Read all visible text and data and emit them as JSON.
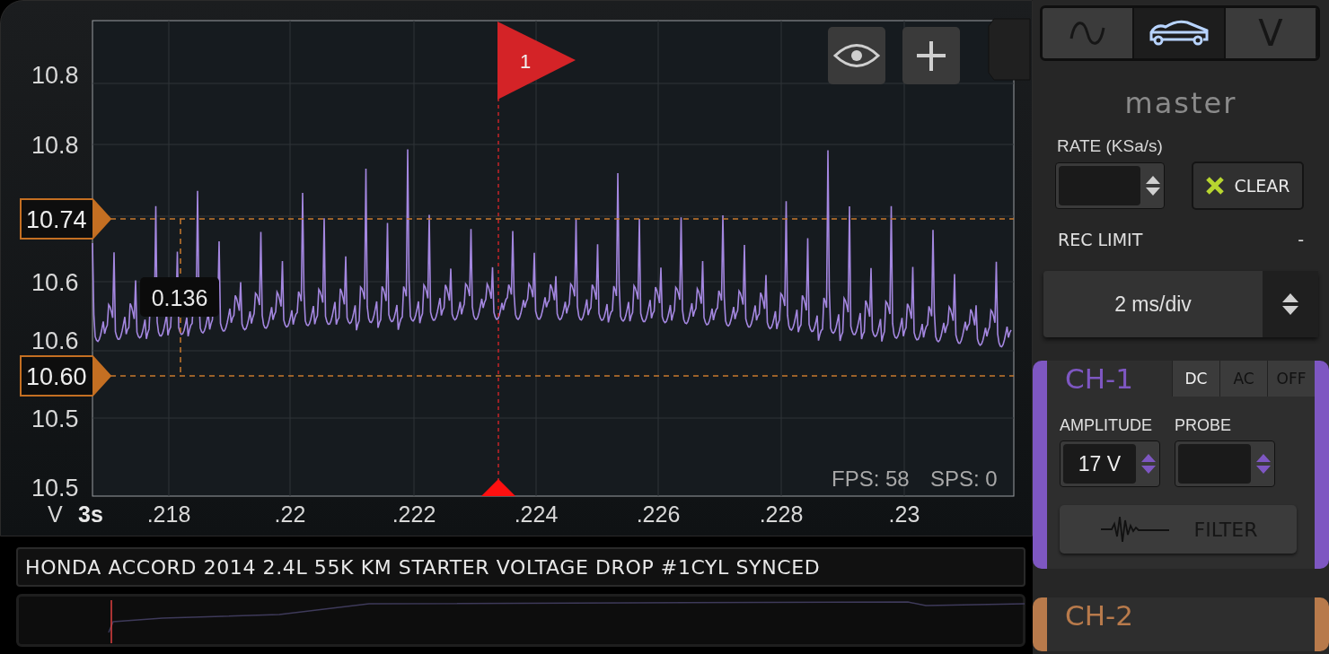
{
  "plot": {
    "y_labels": [
      "10.8",
      "10.8",
      "10.6",
      "10.6",
      "10.5",
      "10.5"
    ],
    "cursor_markers": [
      {
        "label": "10.74"
      },
      {
        "label": "10.60"
      }
    ],
    "delta_readout": "0.136",
    "trigger_flag": "1",
    "axis_unit": "V",
    "timebase": "3s",
    "x_labels": [
      ".218",
      ".22",
      ".222",
      ".224",
      ".226",
      ".228",
      ".23"
    ],
    "stats": [
      "FPS: 58",
      "SPS: 0"
    ]
  },
  "recording_title": "HONDA ACCORD 2014 2.4L 55K KM STARTER VOLTAGE DROP #1CYL SYNCED",
  "mode_tabs": [
    {
      "kind": "sine",
      "selected": false
    },
    {
      "kind": "car",
      "selected": true
    },
    {
      "kind": "text",
      "label": "V",
      "selected": false
    }
  ],
  "master": {
    "title": "master",
    "rate_label": "RATE (KSa/s)",
    "clear_button": "CLEAR",
    "rec_limit_label": "REC LIMIT",
    "rec_limit_value": "-",
    "timebase_select": "2 ms/div"
  },
  "channels": [
    {
      "name": "CH-1",
      "color": "#7e57c2",
      "couplings": [
        {
          "label": "DC",
          "selected": true
        },
        {
          "label": "AC",
          "selected": false
        },
        {
          "label": "OFF",
          "selected": false
        }
      ],
      "amplitude_label": "AMPLITUDE",
      "amplitude": "17 V",
      "probe_label": "PROBE",
      "filter_button": "FILTER"
    },
    {
      "name": "CH-2",
      "color": "#b87a4b"
    }
  ]
}
